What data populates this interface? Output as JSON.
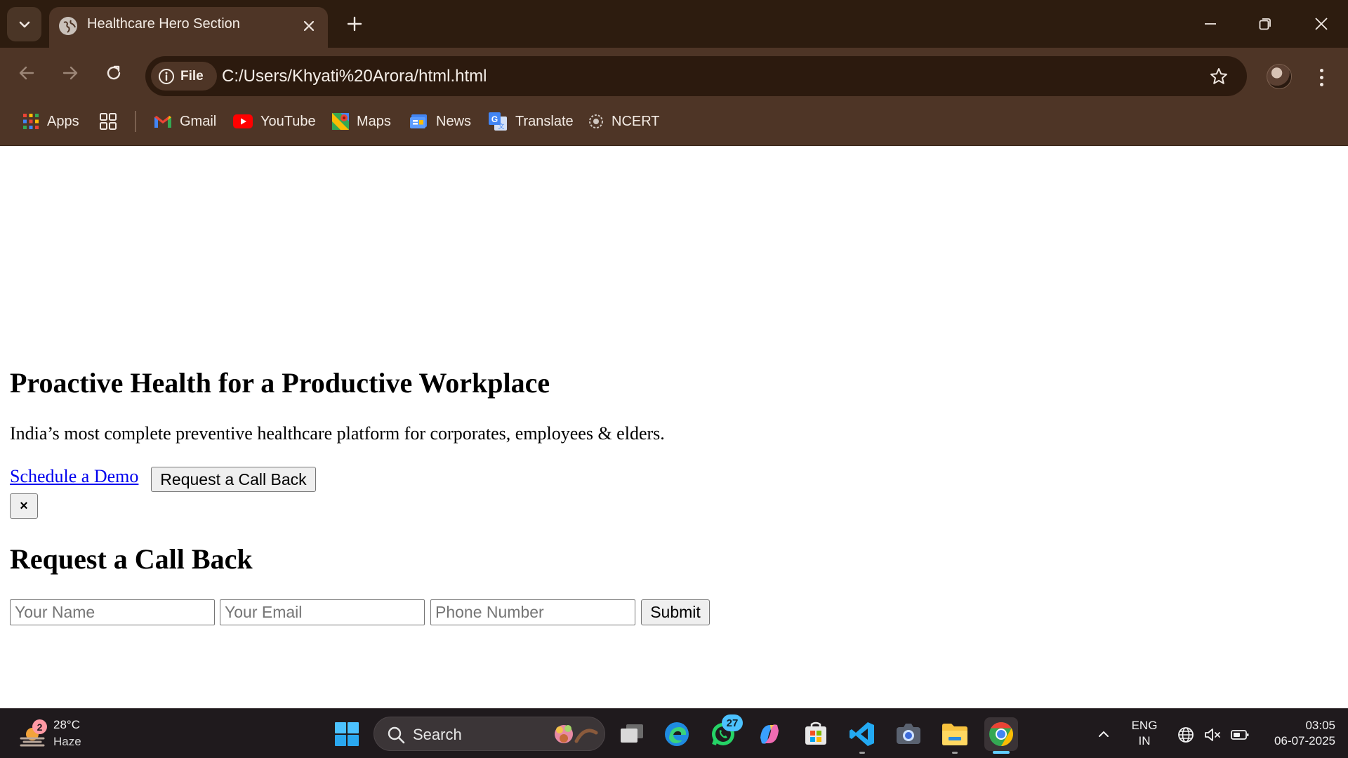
{
  "browser": {
    "tab_title": "Healthcare Hero Section",
    "address_chip": "File",
    "url": "C:/Users/Khyati%20Arora/html.html",
    "bookmarks": [
      {
        "label": "Apps",
        "icon": "apps-grid-icon"
      },
      {
        "label": "Gmail",
        "icon": "gmail-icon"
      },
      {
        "label": "YouTube",
        "icon": "youtube-icon"
      },
      {
        "label": "Maps",
        "icon": "maps-icon"
      },
      {
        "label": "News",
        "icon": "news-icon"
      },
      {
        "label": "Translate",
        "icon": "translate-icon"
      },
      {
        "label": "NCERT",
        "icon": "ncert-icon"
      }
    ]
  },
  "page": {
    "hero_title": "Proactive Health for a Productive Workplace",
    "hero_subtitle": "India’s most complete preventive healthcare platform for corporates, employees & elders.",
    "schedule_link": "Schedule a Demo",
    "callback_button": "Request a Call Back",
    "close_button": "×",
    "form_title": "Request a Call Back",
    "form": {
      "name_placeholder": "Your Name",
      "email_placeholder": "Your Email",
      "phone_placeholder": "Phone Number",
      "submit_label": "Submit"
    }
  },
  "taskbar": {
    "weather_badge": "2",
    "temperature": "28°C",
    "condition": "Haze",
    "search_label": "Search",
    "whatsapp_badge": "27",
    "language_line1": "ENG",
    "language_line2": "IN",
    "time": "03:05",
    "date": "06-07-2025"
  },
  "colors": {
    "tab_strip": "#2d1c0f",
    "toolbar": "#4e3526",
    "link": "#0000ee",
    "taskbar": "#1f1a1d",
    "active_indicator": "#60cdff"
  }
}
